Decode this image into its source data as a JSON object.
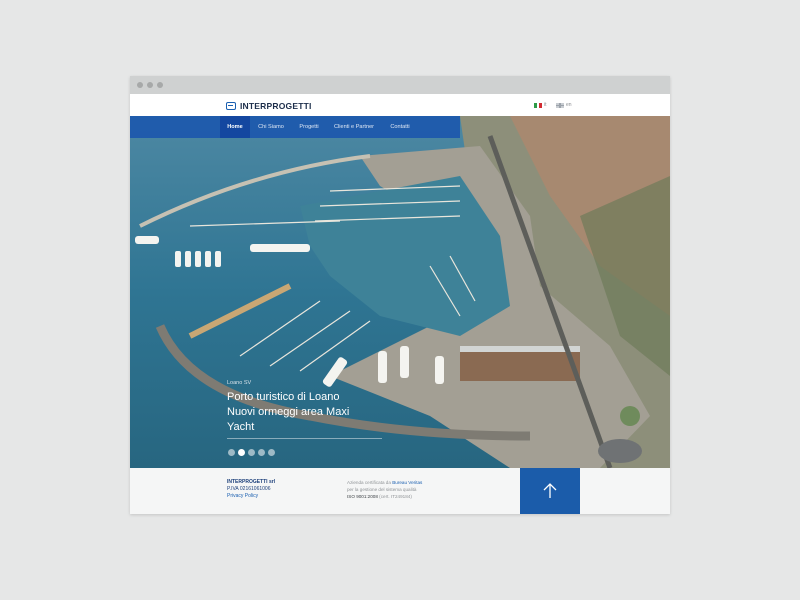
{
  "site": {
    "brand": "INTERPROGETTI",
    "languages": [
      {
        "code": "it"
      },
      {
        "code": "en"
      }
    ]
  },
  "nav": {
    "items": [
      {
        "label": "Home",
        "active": true
      },
      {
        "label": "Chi Siamo",
        "active": false
      },
      {
        "label": "Progetti",
        "active": false
      },
      {
        "label": "Clienti e Partner",
        "active": false
      },
      {
        "label": "Contatti",
        "active": false
      }
    ]
  },
  "slide": {
    "kicker": "Loano SV",
    "title": "Porto turistico di Loano\nNuovi ormeggi area Maxi\nYacht",
    "dots_total": 5,
    "active_index": 1
  },
  "footer": {
    "company_name": "INTERPROGETTI srl",
    "vat": "P.IVA 02161061006",
    "privacy": "Privacy Policy",
    "cert_line1_prefix": "Azienda certificata da ",
    "cert_line1_link": "Bureau Veritas",
    "cert_line2": "per la gestione del sistema qualità",
    "cert_line3_strong": "ISO 9001:2008",
    "cert_line3_rest": " (cert. IT249184)"
  },
  "colors": {
    "brand_blue": "#1a5fb0",
    "nav_bg": "#1c58ac",
    "nav_active": "#1447a0",
    "scroll_top_bg": "#1b5caa"
  },
  "icons": {
    "scroll_top": "arrow-up-icon",
    "logo": "logo-icon"
  }
}
